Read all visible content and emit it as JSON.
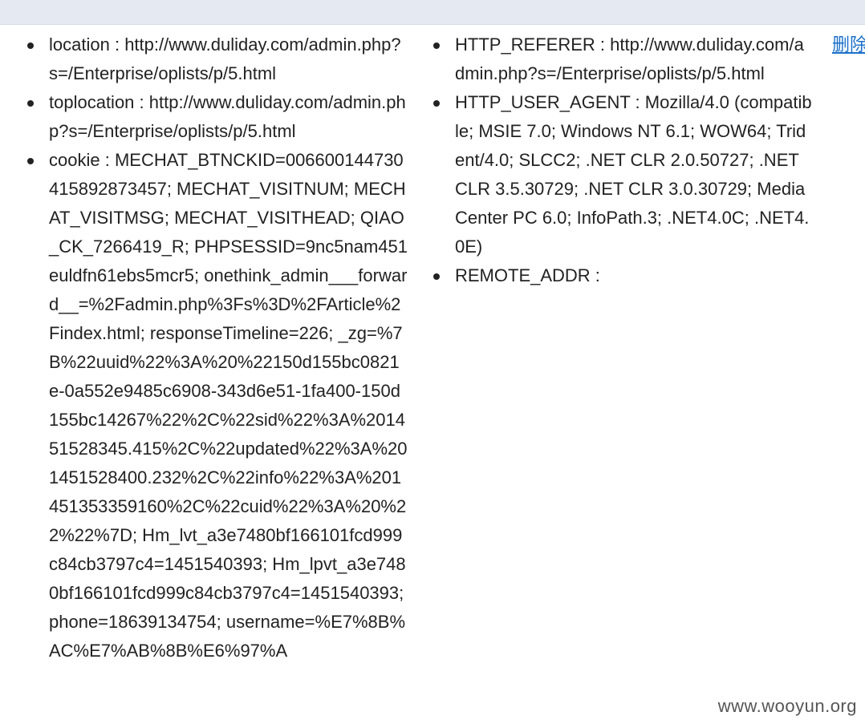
{
  "left_list": [
    {
      "key": "location",
      "sep": " : ",
      "value": "http://www.duliday.com/admin.php?s=/Enterprise/oplists/p/5.html"
    },
    {
      "key": "toplocation",
      "sep": " : ",
      "value": "http://www.duliday.com/admin.php?s=/Enterprise/oplists/p/5.html"
    },
    {
      "key": "cookie",
      "sep": " : ",
      "value": "MECHAT_BTNCKID=006600144730415892873457; MECHAT_VISITNUM; MECHAT_VISITMSG; MECHAT_VISITHEAD; QIAO_CK_7266419_R; PHPSESSID=9nc5nam451euldfn61ebs5mcr5; onethink_admin___forward__=%2Fadmin.php%3Fs%3D%2FArticle%2Findex.html; responseTimeline=226; _zg=%7B%22uuid%22%3A%20%22150d155bc0821e-0a552e9485c6908-343d6e51-1fa400-150d155bc14267%22%2C%22sid%22%3A%201451528345.415%2C%22updated%22%3A%201451528400.232%2C%22info%22%3A%201451353359160%2C%22cuid%22%3A%20%22%22%7D; Hm_lvt_a3e7480bf166101fcd999c84cb3797c4=1451540393; Hm_lpvt_a3e7480bf166101fcd999c84cb3797c4=1451540393; phone=18639134754; username=%E7%8B%AC%E7%AB%8B%E6%97%A"
    }
  ],
  "right_list": [
    {
      "key": "HTTP_REFERER",
      "sep": " : ",
      "value": "http://www.duliday.com/admin.php?s=/Enterprise/oplists/p/5.html"
    },
    {
      "key": "HTTP_USER_AGENT",
      "sep": " : ",
      "value": "Mozilla/4.0 (compatible; MSIE 7.0; Windows NT 6.1; WOW64; Trident/4.0; SLCC2; .NET CLR 2.0.50727; .NET CLR 3.5.30729; .NET CLR 3.0.30729; Media Center PC 6.0; InfoPath.3; .NET4.0C; .NET4.0E)"
    },
    {
      "key": "REMOTE_ADDR",
      "sep": " :",
      "value": ""
    }
  ],
  "actions": {
    "delete_label": "删除"
  },
  "watermark": "www.wooyun.org",
  "colors": {
    "link": "#1a6fc9",
    "top_band": "#e4e9f2"
  }
}
